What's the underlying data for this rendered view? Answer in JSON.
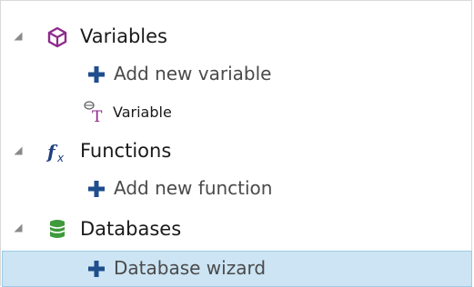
{
  "tree": {
    "groups": [
      {
        "label": "Variables",
        "icon": "cube-icon",
        "children": [
          {
            "label": "Add new variable",
            "icon": "plus-icon"
          },
          {
            "label": "Variable",
            "icon": "variable-type-icon"
          }
        ]
      },
      {
        "label": "Functions",
        "icon": "function-icon",
        "children": [
          {
            "label": "Add new function",
            "icon": "plus-icon"
          }
        ]
      },
      {
        "label": "Databases",
        "icon": "database-icon",
        "children": [
          {
            "label": "Database wizard",
            "icon": "plus-icon",
            "selected": true
          }
        ]
      }
    ]
  },
  "colors": {
    "plus_icon": "#1f4e8c",
    "cube_icon": "#8e2a8b",
    "variable_icon": "#8e2a8b",
    "function_icon": "#1f3f80",
    "database_icon": "#3e9a3a",
    "selection_bg": "#cce4f3",
    "selection_border": "#9ccbe6"
  }
}
